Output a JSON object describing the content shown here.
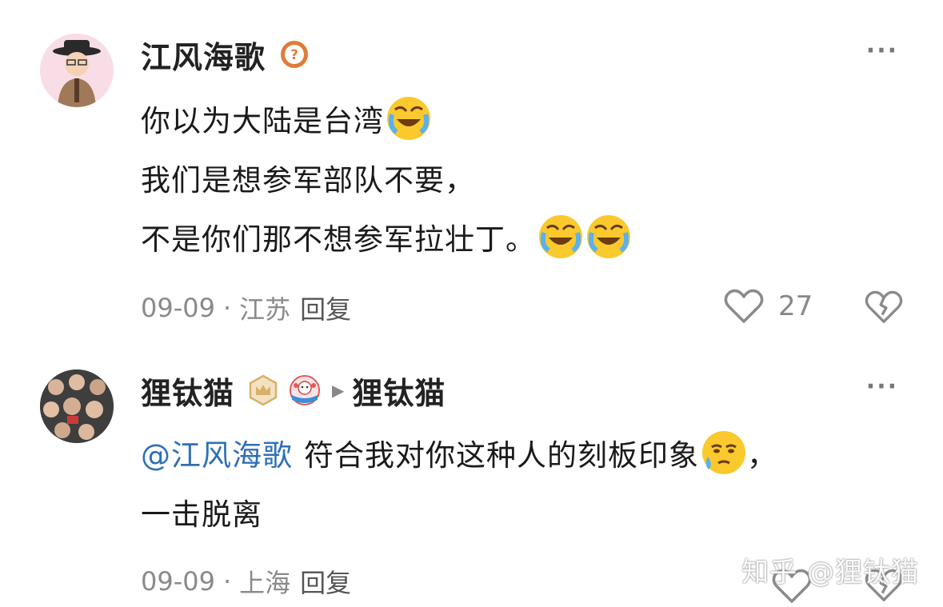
{
  "comments": [
    {
      "author": "江风海歌",
      "lines": [
        "你以为大陆是台湾",
        "我们是想参军部队不要，",
        "不是你们那不想参军拉壮丁。"
      ],
      "date": "09-09",
      "location": "江苏",
      "reply_label": "回复",
      "likes": "27",
      "more_label": "···",
      "emoji_names": [
        "laugh-cry-emoji"
      ]
    },
    {
      "author": "狸钛猫",
      "reply_to": "狸钛猫",
      "mention": "@江风海歌",
      "text": "符合我对你这种人的刻板印象",
      "text_tail": "，",
      "line2": "一击脱离",
      "date": "09-09",
      "location": "上海",
      "reply_label": "回复",
      "more_label": "···"
    }
  ],
  "separator": "·",
  "watermark": "知乎 @狸钛猫",
  "colors": {
    "mention": "#2f6fb8",
    "meta": "#8a8a8a",
    "badge_orange": "#e07b39",
    "badge_gold": "#d8b06a"
  }
}
